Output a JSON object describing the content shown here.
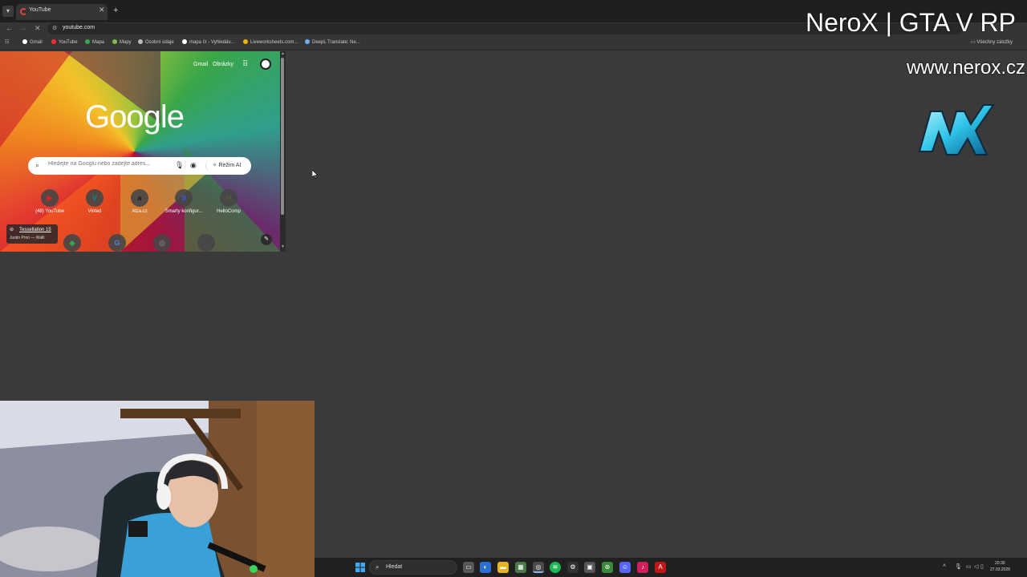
{
  "browser": {
    "tab": {
      "title": "YouTube"
    },
    "new_tab_symbol": "+",
    "url": "youtube.com",
    "bookmarks": [
      {
        "label": "Gmail",
        "color": "#ffffff"
      },
      {
        "label": "YouTube",
        "color": "#ff2a2a"
      },
      {
        "label": "Mapa",
        "color": "#34a853"
      },
      {
        "label": "Mapy",
        "color": "#7bbf4a"
      },
      {
        "label": "Osobní údaje",
        "color": "#bbbbbb"
      },
      {
        "label": "mapa čr - Vyhledáv...",
        "color": "#ffffff"
      },
      {
        "label": "Liveworksheets.com...",
        "color": "#f4b400"
      },
      {
        "label": "DeepL Translate: Ne...",
        "color": "#6ab0ff"
      }
    ],
    "all_bookmarks": "Všechny záložky"
  },
  "google": {
    "gmail": "Gmail",
    "images": "Obrázky",
    "logo": "Google",
    "search_placeholder": "Hledejte na Googlu nebo zadejte adres...",
    "ai_mode": "Režim AI",
    "shortcuts": [
      {
        "label": "(48) YouTube",
        "glyph": "▶",
        "color": "#e02020"
      },
      {
        "label": "Vinted",
        "glyph": "V",
        "color": "#0a8a8a"
      },
      {
        "label": "Alza.cz",
        "glyph": "a",
        "color": "#1b1b1b"
      },
      {
        "label": "Smarty konfigur...",
        "glyph": "S",
        "color": "#3a5bd9"
      },
      {
        "label": "HelloComp",
        "glyph": "H",
        "color": "#5a5a2a"
      }
    ],
    "shortcuts_row2": [
      {
        "glyph": "◆",
        "color": "#34a853"
      },
      {
        "glyph": "G",
        "color": "#4285f4"
      },
      {
        "glyph": "◎",
        "color": "#777777"
      },
      {
        "glyph": "+",
        "color": "#444444"
      }
    ],
    "wallpaper_title": "Tessellation 15",
    "wallpaper_author": "Justin Prno — Walli"
  },
  "overlay": {
    "stream_title": "NeroX | GTA V RP",
    "stream_url": "www.nerox.cz"
  },
  "taskbar": {
    "search_label": "Hledat",
    "time": "20:30",
    "date": "27.03.2026"
  }
}
